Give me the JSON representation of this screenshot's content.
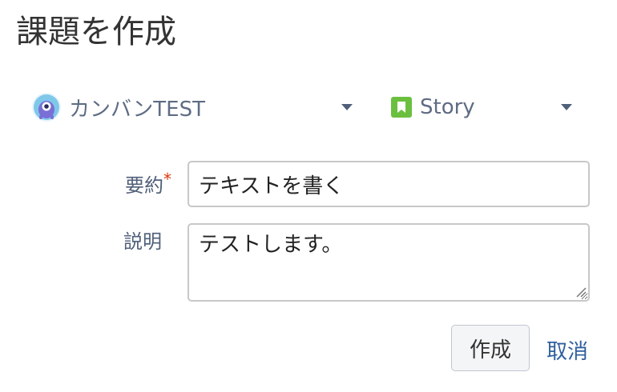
{
  "dialog": {
    "title": "課題を作成"
  },
  "project_selector": {
    "label": "カンバンTEST",
    "avatar_icon": "project-monster-avatar-icon",
    "accent": "#7a6fd6"
  },
  "issue_type_selector": {
    "label": "Story",
    "icon": "story-bookmark-icon",
    "color": "#6bbf3f"
  },
  "summary_field": {
    "label": "要約",
    "required_marker": "*",
    "value": "テキストを書く"
  },
  "description_field": {
    "label": "説明",
    "value": "テストします。"
  },
  "actions": {
    "create_label": "作成",
    "cancel_label": "取消",
    "link_color": "#2f5f9e"
  }
}
